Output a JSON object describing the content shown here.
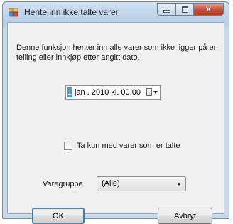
{
  "window": {
    "title": "Hente inn ikke talte varer",
    "icon": "grid-app-icon",
    "caption_buttons": [
      "minimize-icon",
      "maximize-icon",
      "close-icon"
    ],
    "close_glyph": "✕"
  },
  "dialog": {
    "description": "Denne funksjon henter inn alle varer som ikke ligger på en telling eller innkjøp etter angitt dato.",
    "date": {
      "day": "1",
      "rest": "jan . 2010   kl. 00.00"
    },
    "checkbox": {
      "label": "Ta kun med varer som er talte",
      "checked": false
    },
    "group": {
      "label": "Varegruppe",
      "selected": "(Alle)"
    },
    "buttons": {
      "ok": "OK",
      "cancel": "Avbryt"
    }
  },
  "colors": {
    "selection": "#3399ff",
    "close_button": "#c9513a"
  }
}
